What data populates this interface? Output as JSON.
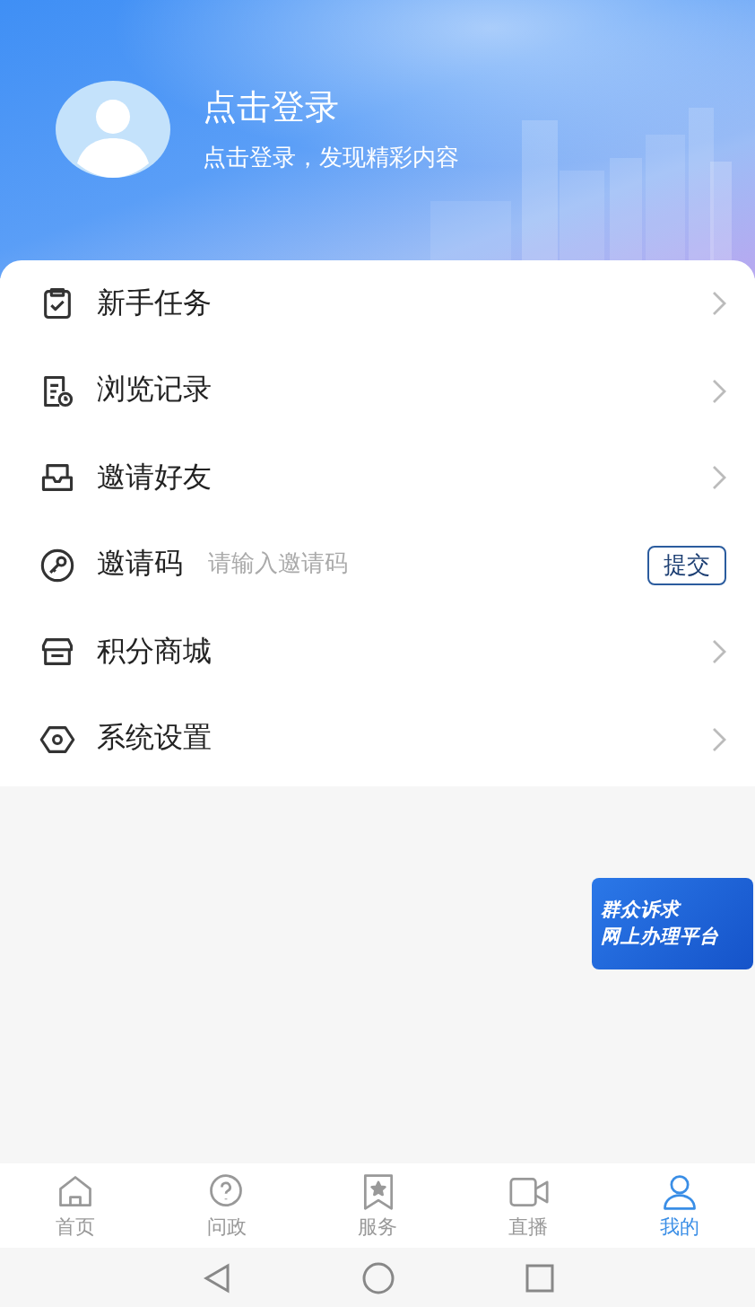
{
  "profile": {
    "title": "点击登录",
    "subtitle": "点击登录，发现精彩内容"
  },
  "menu": [
    {
      "kind": "link",
      "label": "新手任务"
    },
    {
      "kind": "link",
      "label": "浏览记录"
    },
    {
      "kind": "link",
      "label": "邀请好友"
    },
    {
      "kind": "input",
      "label": "邀请码",
      "placeholder": "请输入邀请码",
      "button": "提交"
    },
    {
      "kind": "link",
      "label": "积分商城"
    },
    {
      "kind": "link",
      "label": "系统设置"
    }
  ],
  "banner": {
    "lines": [
      "群众诉求",
      "网上办理平台"
    ]
  },
  "tabs": [
    {
      "label": "首页",
      "selected": false
    },
    {
      "label": "问政",
      "selected": false
    },
    {
      "label": "服务",
      "selected": false
    },
    {
      "label": "直播",
      "selected": false
    },
    {
      "label": "我的",
      "selected": true
    }
  ]
}
